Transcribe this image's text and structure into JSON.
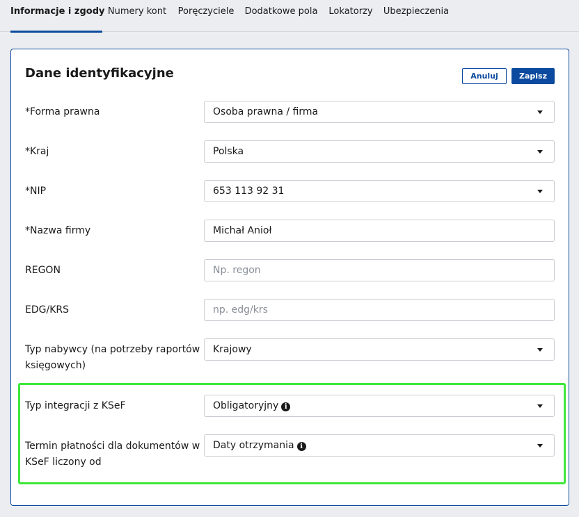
{
  "tabs": [
    {
      "label": "Informacje i zgody",
      "active": true
    },
    {
      "label": "Numery kont"
    },
    {
      "label": "Poręczyciele"
    },
    {
      "label": "Dodatkowe pola"
    },
    {
      "label": "Lokatorzy"
    },
    {
      "label": "Ubezpieczenia"
    }
  ],
  "section": {
    "title": "Dane identyfikacyjne",
    "cancel_label": "Anuluj",
    "save_label": "Zapisz"
  },
  "fields": {
    "forma_prawna": {
      "label": "*Forma prawna",
      "value": "Osoba prawna / firma"
    },
    "kraj": {
      "label": "*Kraj",
      "value": "Polska"
    },
    "nip": {
      "label": "*NIP",
      "value": "653 113 92 31"
    },
    "nazwa_firmy": {
      "label": "*Nazwa firmy",
      "value": "Michał Anioł"
    },
    "regon": {
      "label": "REGON",
      "value": "",
      "placeholder": "Np. regon"
    },
    "edg_krs": {
      "label": "EDG/KRS",
      "value": "",
      "placeholder": "np. edg/krs"
    },
    "typ_nabywcy": {
      "label": "Typ nabywcy (na potrzeby raportów księgowych)",
      "value": "Krajowy"
    },
    "typ_integracji": {
      "label": "Typ integracji z KSeF",
      "value": "Obligatoryjny",
      "icon": "info-icon"
    },
    "termin_platnosci": {
      "label": "Termin płatności dla dokumentów w KSeF liczony od",
      "value": "Daty otrzymania",
      "icon": "info-icon"
    }
  },
  "colors": {
    "accent": "#0b4a9e",
    "highlight": "#3ee83b",
    "background": "#ecedf0"
  }
}
